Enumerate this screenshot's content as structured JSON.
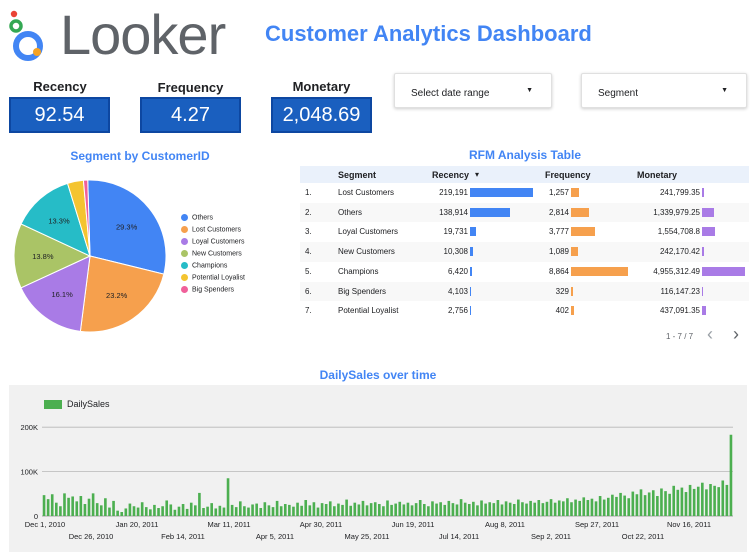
{
  "header": {
    "logo_text": "Looker",
    "title": "Customer Analytics Dashboard"
  },
  "kpis": [
    {
      "label": "Recency",
      "value": "92.54"
    },
    {
      "label": "Frequency",
      "value": "4.27"
    },
    {
      "label": "Monetary",
      "value": "2,048.69"
    }
  ],
  "controls": {
    "date_range": "Select date range",
    "segment": "Segment"
  },
  "colors": {
    "brand_blue": "#4285f4",
    "kpi_box": "#1a5fbf",
    "recency_bar": "#4285f4",
    "frequency_bar": "#f6a04d",
    "monetary_bar": "#a97be6",
    "sales_bar": "#4caf50",
    "logo_orange": "#f4a224",
    "logo_blue": "#4285f4",
    "logo_green": "#34a853",
    "logo_red": "#ea4335"
  },
  "pie": {
    "title": "Segment by CustomerID",
    "chart_data": {
      "type": "pie",
      "labels": [
        "Others",
        "Lost Customers",
        "Loyal Customers",
        "New Customers",
        "Champions",
        "Potential Loyalist",
        "Big Spenders"
      ],
      "values": [
        29.3,
        23.2,
        16.1,
        13.8,
        13.3,
        3.4,
        0.9
      ],
      "colors": [
        "#4285f4",
        "#f6a04d",
        "#a97be6",
        "#aac466",
        "#26bcc7",
        "#f4c430",
        "#f0609a"
      ],
      "slice_labels": [
        "29.3%",
        "23.2%",
        "16.1%",
        "13.8%",
        "13.3%",
        "",
        ""
      ],
      "legend_position": "right"
    }
  },
  "table": {
    "title": "RFM Analysis Table",
    "headers": {
      "segment": "Segment",
      "recency": "Recency",
      "frequency": "Frequency",
      "monetary": "Monetary"
    },
    "sort_icon": "▾",
    "rows": [
      {
        "idx": "1.",
        "segment": "Lost Customers",
        "recency": "219,191",
        "frequency": "1,257",
        "monetary": "241,799.35",
        "r": 219191,
        "f": 1257,
        "m": 241799.35
      },
      {
        "idx": "2.",
        "segment": "Others",
        "recency": "138,914",
        "frequency": "2,814",
        "monetary": "1,339,979.25",
        "r": 138914,
        "f": 2814,
        "m": 1339979.25
      },
      {
        "idx": "3.",
        "segment": "Loyal Customers",
        "recency": "19,731",
        "frequency": "3,777",
        "monetary": "1,554,708.8",
        "r": 19731,
        "f": 3777,
        "m": 1554708.8
      },
      {
        "idx": "4.",
        "segment": "New Customers",
        "recency": "10,308",
        "frequency": "1,089",
        "monetary": "242,170.42",
        "r": 10308,
        "f": 1089,
        "m": 242170.42
      },
      {
        "idx": "5.",
        "segment": "Champions",
        "recency": "6,420",
        "frequency": "8,864",
        "monetary": "4,955,312.49",
        "r": 6420,
        "f": 8864,
        "m": 4955312.49
      },
      {
        "idx": "6.",
        "segment": "Big Spenders",
        "recency": "4,103",
        "frequency": "329",
        "monetary": "116,147.23",
        "r": 4103,
        "f": 329,
        "m": 116147.23
      },
      {
        "idx": "7.",
        "segment": "Potential Loyalist",
        "recency": "2,756",
        "frequency": "402",
        "monetary": "437,091.35",
        "r": 2756,
        "f": 402,
        "m": 437091.35
      }
    ],
    "pagination": "1 - 7 / 7",
    "prev_icon": "‹",
    "next_icon": "›"
  },
  "sales": {
    "title": "DailySales over time",
    "chart_data": {
      "type": "bar",
      "series": [
        {
          "name": "DailySales"
        }
      ],
      "ylim": [
        0,
        250000
      ],
      "yticks": [
        0,
        100000,
        200000
      ],
      "ytick_labels": [
        "0",
        "100K",
        "200K"
      ],
      "x_range": [
        "Dec 1, 2010",
        "Dec 9, 2011"
      ],
      "xtick_labels_row1": [
        "Dec 1, 2010",
        "Jan 20, 2011",
        "Mar 11, 2011",
        "Apr 30, 2011",
        "Jun 19, 2011",
        "Aug 8, 2011",
        "Sep 27, 2011",
        "Nov 16, 2011"
      ],
      "xtick_labels_row2": [
        "Dec 26, 2010",
        "Feb 14, 2011",
        "Apr 5, 2011",
        "May 25, 2011",
        "Jul 14, 2011",
        "Sep 2, 2011",
        "Oct 22, 2011"
      ],
      "values": [
        47000,
        38000,
        49000,
        30000,
        22000,
        51000,
        41000,
        44000,
        33000,
        45000,
        27000,
        39000,
        51000,
        29000,
        24000,
        40000,
        19000,
        34000,
        12000,
        9000,
        17000,
        28000,
        22000,
        19000,
        31000,
        20000,
        15000,
        25000,
        18000,
        22000,
        35000,
        26000,
        14000,
        21000,
        27000,
        16000,
        30000,
        24000,
        52000,
        18000,
        21000,
        29000,
        17000,
        23000,
        19000,
        85000,
        25000,
        20000,
        33000,
        22000,
        19000,
        26000,
        28000,
        18000,
        31000,
        24000,
        20000,
        34000,
        22000,
        27000,
        25000,
        21000,
        30000,
        23000,
        36000,
        24000,
        31000,
        19000,
        29000,
        27000,
        33000,
        22000,
        28000,
        25000,
        37000,
        23000,
        30000,
        26000,
        34000,
        24000,
        29000,
        31000,
        27000,
        22000,
        35000,
        25000,
        28000,
        32000,
        26000,
        30000,
        24000,
        29000,
        36000,
        27000,
        22000,
        33000,
        28000,
        31000,
        25000,
        34000,
        29000,
        26000,
        38000,
        30000,
        27000,
        32000,
        24000,
        35000,
        28000,
        31000,
        29000,
        36000,
        26000,
        33000,
        30000,
        27000,
        37000,
        31000,
        28000,
        34000,
        30000,
        36000,
        29000,
        32000,
        38000,
        30000,
        35000,
        33000,
        40000,
        31000,
        37000,
        34000,
        42000,
        36000,
        39000,
        33000,
        45000,
        37000,
        41000,
        48000,
        43000,
        52000,
        46000,
        40000,
        55000,
        49000,
        60000,
        47000,
        53000,
        58000,
        45000,
        62000,
        56000,
        50000,
        68000,
        59000,
        64000,
        54000,
        70000,
        61000,
        66000,
        75000,
        60000,
        72000,
        68000,
        65000,
        80000,
        70000,
        183000
      ]
    }
  }
}
